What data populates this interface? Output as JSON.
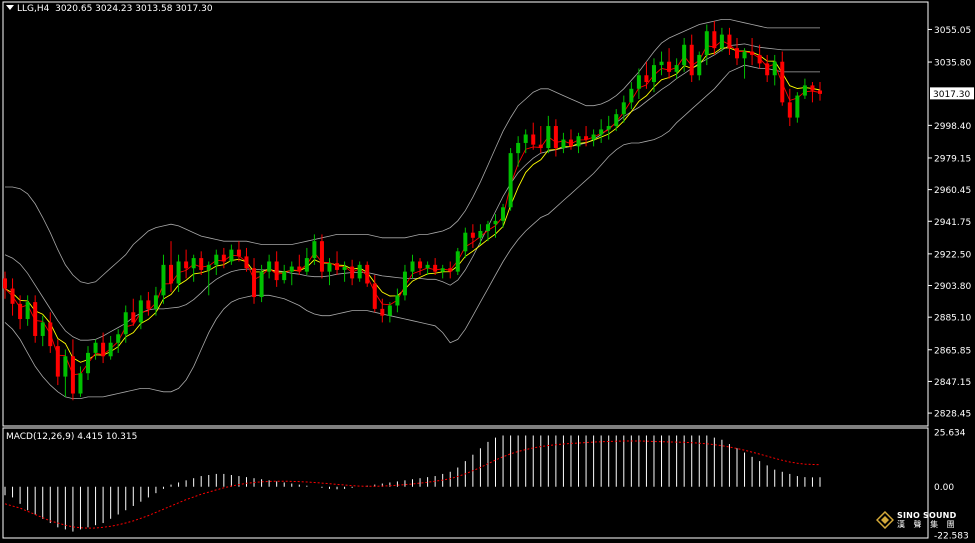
{
  "header": {
    "symbol": "LLG,H4",
    "ohlc": "3020.65 3024.23 3013.58 3017.30"
  },
  "indicator": {
    "label": "MACD(12,26,9) 4.415 10.315"
  },
  "logo": {
    "name": "SINO SOUND",
    "chinese": "漢 聲 集 團"
  },
  "colors": {
    "up": "#00c000",
    "down": "#ff0000",
    "band": "#a8a8a8",
    "ma_fast": "#ff0000",
    "ma_slow": "#ffff00",
    "macd_hist": "#ffffff",
    "macd_signal": "#ff0000",
    "grid": "#ffffff"
  },
  "chart_data": {
    "type": "candlestick",
    "title": "LLG,H4",
    "price_axis": {
      "ticks": [
        3055.05,
        3035.8,
        2998.4,
        2979.15,
        2960.45,
        2941.75,
        2922.5,
        2903.8,
        2885.1,
        2865.85,
        2847.15,
        2828.45
      ],
      "tick_labels": [
        "3055.05",
        "3035.80",
        "2998.40",
        "2979.15",
        "2960.45",
        "2941.75",
        "2922.50",
        "2903.80",
        "2885.10",
        "2865.85",
        "2847.15",
        "2828.45"
      ],
      "ylim": [
        2822,
        3063
      ],
      "current_price": 3017.3,
      "current_label": "3017.30"
    },
    "macd_axis": {
      "ticks": [
        25.634,
        0.0,
        -22.583
      ],
      "tick_labels": [
        "25.634",
        "0.00",
        "-22.583"
      ],
      "ylim": [
        -24,
        27.5
      ]
    },
    "candles": [
      [
        2908,
        2912,
        2896,
        2902
      ],
      [
        2902,
        2908,
        2886,
        2893
      ],
      [
        2893,
        2898,
        2878,
        2884
      ],
      [
        2884,
        2898,
        2880,
        2894
      ],
      [
        2894,
        2898,
        2870,
        2874
      ],
      [
        2874,
        2886,
        2868,
        2882
      ],
      [
        2882,
        2888,
        2864,
        2868
      ],
      [
        2868,
        2872,
        2845,
        2850
      ],
      [
        2850,
        2866,
        2838,
        2862
      ],
      [
        2862,
        2872,
        2836,
        2840
      ],
      [
        2840,
        2856,
        2838,
        2852
      ],
      [
        2852,
        2868,
        2848,
        2864
      ],
      [
        2864,
        2872,
        2860,
        2870
      ],
      [
        2870,
        2876,
        2858,
        2862
      ],
      [
        2862,
        2874,
        2860,
        2870
      ],
      [
        2870,
        2878,
        2864,
        2875
      ],
      [
        2875,
        2892,
        2870,
        2888
      ],
      [
        2888,
        2896,
        2880,
        2882
      ],
      [
        2882,
        2898,
        2878,
        2895
      ],
      [
        2895,
        2900,
        2886,
        2890
      ],
      [
        2890,
        2903,
        2886,
        2898
      ],
      [
        2898,
        2922,
        2893,
        2916
      ],
      [
        2916,
        2930,
        2900,
        2905
      ],
      [
        2905,
        2922,
        2900,
        2918
      ],
      [
        2918,
        2925,
        2908,
        2914
      ],
      [
        2914,
        2922,
        2906,
        2920
      ],
      [
        2920,
        2924,
        2910,
        2913
      ],
      [
        2913,
        2918,
        2898,
        2916
      ],
      [
        2916,
        2925,
        2910,
        2922
      ],
      [
        2922,
        2926,
        2914,
        2918
      ],
      [
        2918,
        2928,
        2916,
        2925
      ],
      [
        2925,
        2930,
        2918,
        2921
      ],
      [
        2921,
        2926,
        2912,
        2914
      ],
      [
        2914,
        2920,
        2893,
        2897
      ],
      [
        2897,
        2916,
        2894,
        2912
      ],
      [
        2912,
        2922,
        2908,
        2918
      ],
      [
        2918,
        2924,
        2903,
        2907
      ],
      [
        2907,
        2916,
        2905,
        2912
      ],
      [
        2912,
        2918,
        2904,
        2915
      ],
      [
        2915,
        2922,
        2910,
        2912
      ],
      [
        2912,
        2926,
        2910,
        2920
      ],
      [
        2920,
        2934,
        2916,
        2930
      ],
      [
        2930,
        2934,
        2908,
        2912
      ],
      [
        2912,
        2920,
        2904,
        2917
      ],
      [
        2917,
        2924,
        2910,
        2913
      ],
      [
        2913,
        2918,
        2906,
        2915
      ],
      [
        2915,
        2919,
        2904,
        2908
      ],
      [
        2908,
        2918,
        2906,
        2916
      ],
      [
        2916,
        2918,
        2903,
        2905
      ],
      [
        2905,
        2910,
        2888,
        2890
      ],
      [
        2890,
        2896,
        2882,
        2886
      ],
      [
        2886,
        2894,
        2882,
        2892
      ],
      [
        2892,
        2902,
        2888,
        2898
      ],
      [
        2898,
        2916,
        2895,
        2912
      ],
      [
        2912,
        2922,
        2908,
        2918
      ],
      [
        2918,
        2920,
        2910,
        2914
      ],
      [
        2914,
        2918,
        2910,
        2916
      ],
      [
        2916,
        2920,
        2910,
        2912
      ],
      [
        2912,
        2916,
        2908,
        2914
      ],
      [
        2914,
        2918,
        2908,
        2912
      ],
      [
        2912,
        2926,
        2910,
        2924
      ],
      [
        2924,
        2938,
        2920,
        2935
      ],
      [
        2935,
        2940,
        2926,
        2932
      ],
      [
        2932,
        2940,
        2928,
        2936
      ],
      [
        2936,
        2942,
        2930,
        2940
      ],
      [
        2940,
        2946,
        2932,
        2942
      ],
      [
        2942,
        2952,
        2938,
        2950
      ],
      [
        2950,
        2985,
        2948,
        2982
      ],
      [
        2982,
        2992,
        2974,
        2988
      ],
      [
        2988,
        2996,
        2982,
        2993
      ],
      [
        2993,
        3000,
        2984,
        2987
      ],
      [
        2987,
        2998,
        2982,
        2985
      ],
      [
        2985,
        3004,
        2982,
        2998
      ],
      [
        2998,
        3002,
        2980,
        2985
      ],
      [
        2985,
        2994,
        2982,
        2990
      ],
      [
        2990,
        2996,
        2984,
        2986
      ],
      [
        2986,
        2994,
        2982,
        2992
      ],
      [
        2992,
        2998,
        2986,
        2990
      ],
      [
        2990,
        2996,
        2986,
        2993
      ],
      [
        2993,
        3002,
        2988,
        2996
      ],
      [
        2996,
        3004,
        2990,
        2998
      ],
      [
        2998,
        3008,
        2995,
        3005
      ],
      [
        3005,
        3016,
        3000,
        3012
      ],
      [
        3012,
        3024,
        3008,
        3020
      ],
      [
        3020,
        3032,
        3014,
        3028
      ],
      [
        3028,
        3036,
        3020,
        3024
      ],
      [
        3024,
        3038,
        3018,
        3034
      ],
      [
        3034,
        3042,
        3028,
        3036
      ],
      [
        3036,
        3044,
        3026,
        3030
      ],
      [
        3030,
        3038,
        3026,
        3034
      ],
      [
        3034,
        3050,
        3030,
        3046
      ],
      [
        3046,
        3052,
        3024,
        3028
      ],
      [
        3028,
        3042,
        3025,
        3040
      ],
      [
        3040,
        3058,
        3034,
        3054
      ],
      [
        3054,
        3060,
        3040,
        3044
      ],
      [
        3044,
        3056,
        3042,
        3052
      ],
      [
        3052,
        3056,
        3040,
        3044
      ],
      [
        3044,
        3050,
        3034,
        3038
      ],
      [
        3038,
        3044,
        3026,
        3042
      ],
      [
        3042,
        3050,
        3034,
        3040
      ],
      [
        3040,
        3046,
        3032,
        3035
      ],
      [
        3035,
        3040,
        3024,
        3028
      ],
      [
        3028,
        3040,
        3022,
        3036
      ],
      [
        3036,
        3042,
        3010,
        3012
      ],
      [
        3012,
        3020,
        2998,
        3003
      ],
      [
        3003,
        3018,
        3000,
        3016
      ],
      [
        3016,
        3026,
        3014,
        3022
      ],
      [
        3022,
        3024,
        3012,
        3019
      ],
      [
        3019,
        3024,
        3013,
        3017
      ]
    ],
    "macd_hist": [
      -4,
      -5,
      -8,
      -11,
      -13,
      -15,
      -17,
      -19,
      -20,
      -21,
      -20,
      -19,
      -18,
      -17,
      -15,
      -13,
      -11,
      -9,
      -7,
      -5,
      -3,
      -1,
      1,
      2,
      3,
      4,
      5,
      5.5,
      6,
      6,
      5.5,
      5,
      4.5,
      4,
      3.5,
      3,
      2.5,
      2,
      1.5,
      1,
      0.5,
      0,
      -0.5,
      -1,
      -1.2,
      -1,
      -0.5,
      0,
      0.5,
      1,
      1.5,
      2,
      2.5,
      3,
      3.5,
      4,
      4.5,
      5,
      6,
      7,
      9,
      12,
      15,
      18,
      21,
      23,
      24,
      24,
      24,
      24,
      24,
      24,
      24,
      24,
      24,
      24,
      24,
      24,
      24,
      24,
      24,
      24,
      24,
      24,
      24,
      24,
      24,
      24,
      24,
      24,
      24,
      24,
      24,
      24,
      23,
      22,
      20,
      18,
      16,
      14,
      12,
      10,
      8,
      7,
      6,
      5,
      4.5,
      4.4,
      4.415
    ],
    "macd_signal": [
      -8,
      -9,
      -10,
      -11.5,
      -13,
      -14.5,
      -16,
      -17,
      -18,
      -18.8,
      -19.2,
      -19.4,
      -19.3,
      -19,
      -18.5,
      -17.8,
      -17,
      -16,
      -14.8,
      -13.5,
      -12,
      -10.5,
      -9,
      -7.5,
      -6,
      -4.8,
      -3.5,
      -2.5,
      -1.5,
      -0.5,
      0.3,
      1,
      1.6,
      2,
      2.3,
      2.5,
      2.6,
      2.6,
      2.5,
      2.4,
      2.2,
      2,
      1.7,
      1.4,
      1.1,
      0.8,
      0.5,
      0.3,
      0.2,
      0.2,
      0.3,
      0.5,
      0.7,
      1,
      1.3,
      1.7,
      2.1,
      2.6,
      3.1,
      3.8,
      4.8,
      6,
      7.5,
      9,
      10.8,
      12.5,
      14,
      15.4,
      16.5,
      17.4,
      18.2,
      18.8,
      19.3,
      19.7,
      20,
      20.3,
      20.5,
      20.7,
      20.9,
      21.1,
      21.2,
      21.3,
      21.4,
      21.4,
      21.4,
      21.3,
      21.2,
      21.1,
      21,
      20.9,
      20.8,
      20.6,
      20.4,
      20.1,
      19.7,
      19.2,
      18.6,
      17.9,
      17.1,
      16.2,
      15.3,
      14.3,
      13.3,
      12.4,
      11.6,
      11,
      10.6,
      10.4,
      10.315
    ],
    "band_upper": [
      2962,
      2962,
      2961,
      2958,
      2952,
      2944,
      2935,
      2925,
      2916,
      2910,
      2906,
      2905,
      2906,
      2910,
      2914,
      2918,
      2922,
      2928,
      2932,
      2936,
      2938,
      2939,
      2940,
      2939,
      2937,
      2935,
      2933,
      2932,
      2931,
      2930,
      2930,
      2930,
      2930,
      2929,
      2928,
      2928,
      2928,
      2928,
      2928,
      2929,
      2930,
      2931,
      2932,
      2933,
      2934,
      2934,
      2934,
      2934,
      2934,
      2933,
      2932,
      2932,
      2932,
      2932,
      2933,
      2934,
      2934,
      2935,
      2936,
      2938,
      2942,
      2948,
      2956,
      2965,
      2975,
      2985,
      2995,
      3003,
      3010,
      3014,
      3018,
      3020,
      3020,
      3018,
      3016,
      3014,
      3012,
      3010,
      3010,
      3011,
      3013,
      3016,
      3020,
      3025,
      3030,
      3036,
      3042,
      3047,
      3050,
      3052,
      3054,
      3056,
      3058,
      3059,
      3060,
      3061,
      3061,
      3060,
      3059,
      3058,
      3057,
      3056,
      3056,
      3056,
      3056,
      3056,
      3056,
      3056,
      3056
    ],
    "band_lower": [
      2882,
      2878,
      2872,
      2864,
      2856,
      2850,
      2845,
      2841,
      2838,
      2837,
      2837,
      2838,
      2838,
      2838,
      2839,
      2840,
      2841,
      2842,
      2843,
      2843,
      2842,
      2841,
      2841,
      2843,
      2848,
      2856,
      2866,
      2876,
      2884,
      2890,
      2894,
      2896,
      2897,
      2898,
      2898,
      2898,
      2897,
      2896,
      2894,
      2892,
      2889,
      2887,
      2886,
      2886,
      2887,
      2888,
      2889,
      2889,
      2889,
      2888,
      2887,
      2886,
      2885,
      2884,
      2883,
      2882,
      2881,
      2880,
      2876,
      2870,
      2872,
      2878,
      2886,
      2894,
      2902,
      2910,
      2918,
      2925,
      2931,
      2936,
      2940,
      2944,
      2946,
      2950,
      2954,
      2958,
      2962,
      2966,
      2970,
      2975,
      2980,
      2984,
      2987,
      2988,
      2988,
      2989,
      2990,
      2992,
      2995,
      3000,
      3004,
      3008,
      3012,
      3016,
      3020,
      3025,
      3030,
      3032,
      3034,
      3033,
      3032,
      3032,
      3031,
      3030,
      3030,
      3030,
      3030,
      3030,
      3030
    ]
  }
}
